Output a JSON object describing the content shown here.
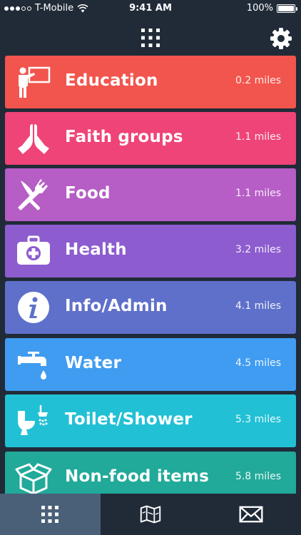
{
  "status_bar": {
    "carrier": "T-Mobile",
    "time": "9:41 AM",
    "battery": "100%",
    "battery_level": 1.0,
    "signal_bars": 3,
    "signal_total": 5
  },
  "top_nav": {
    "grid_icon": "grid-icon",
    "settings_icon": "gear-icon"
  },
  "categories": [
    {
      "label": "Education",
      "distance": "0.2 miles",
      "color": "#f1554d",
      "icon": "teacher-icon"
    },
    {
      "label": "Faith groups",
      "distance": "1.1 miles",
      "color": "#ef4478",
      "icon": "praying-hands-icon"
    },
    {
      "label": "Food",
      "distance": "1.1 miles",
      "color": "#b65dc6",
      "icon": "fork-knife-icon"
    },
    {
      "label": "Health",
      "distance": "3.2 miles",
      "color": "#8d5ccf",
      "icon": "first-aid-kit-icon"
    },
    {
      "label": "Info/Admin",
      "distance": "4.1 miles",
      "color": "#5f70cb",
      "icon": "info-icon"
    },
    {
      "label": "Water",
      "distance": "4.5 miles",
      "color": "#409cf0",
      "icon": "water-tap-icon"
    },
    {
      "label": "Toilet/Shower",
      "distance": "5.3 miles",
      "color": "#22c0d5",
      "icon": "toilet-shower-icon"
    },
    {
      "label": "Non-food items",
      "distance": "5.8 miles",
      "color": "#21a99a",
      "icon": "box-icon"
    }
  ],
  "tabs": [
    {
      "icon": "grid-icon",
      "active": true
    },
    {
      "icon": "map-icon",
      "active": false
    },
    {
      "icon": "envelope-icon",
      "active": false
    }
  ]
}
